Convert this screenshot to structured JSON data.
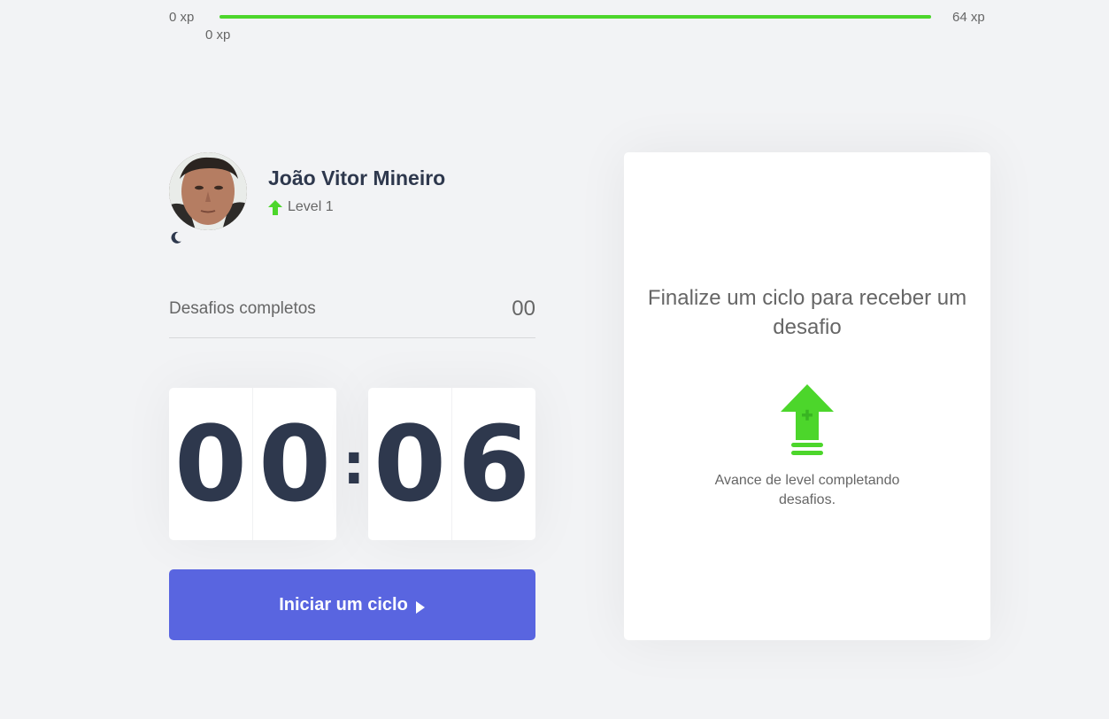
{
  "xp": {
    "min_label": "0 xp",
    "max_label": "64 xp",
    "current_label": "0 xp",
    "progress_fraction": 1.0,
    "bar_color": "#4cd62b"
  },
  "profile": {
    "name": "João Vitor Mineiro",
    "level_label": "Level 1",
    "level_icon": "level-up-arrow-icon",
    "theme_icon": "moon-icon"
  },
  "completed_challenges": {
    "label": "Desafios completos",
    "value": "00"
  },
  "countdown": {
    "minutes": [
      "0",
      "0"
    ],
    "separator": ":",
    "seconds": [
      "0",
      "6"
    ]
  },
  "start_button": {
    "label": "Iniciar um ciclo",
    "icon": "play-icon",
    "color": "#5965e0"
  },
  "challenge_box": {
    "title": "Finalize um ciclo para receber um desafio",
    "icon": "level-up-icon",
    "text": "Avance de level completando desafios."
  },
  "colors": {
    "accent_green": "#4cd62b",
    "accent_blue": "#5965e0",
    "title_dark": "#2e384d",
    "text": "#666666",
    "background": "#f2f3f5"
  }
}
